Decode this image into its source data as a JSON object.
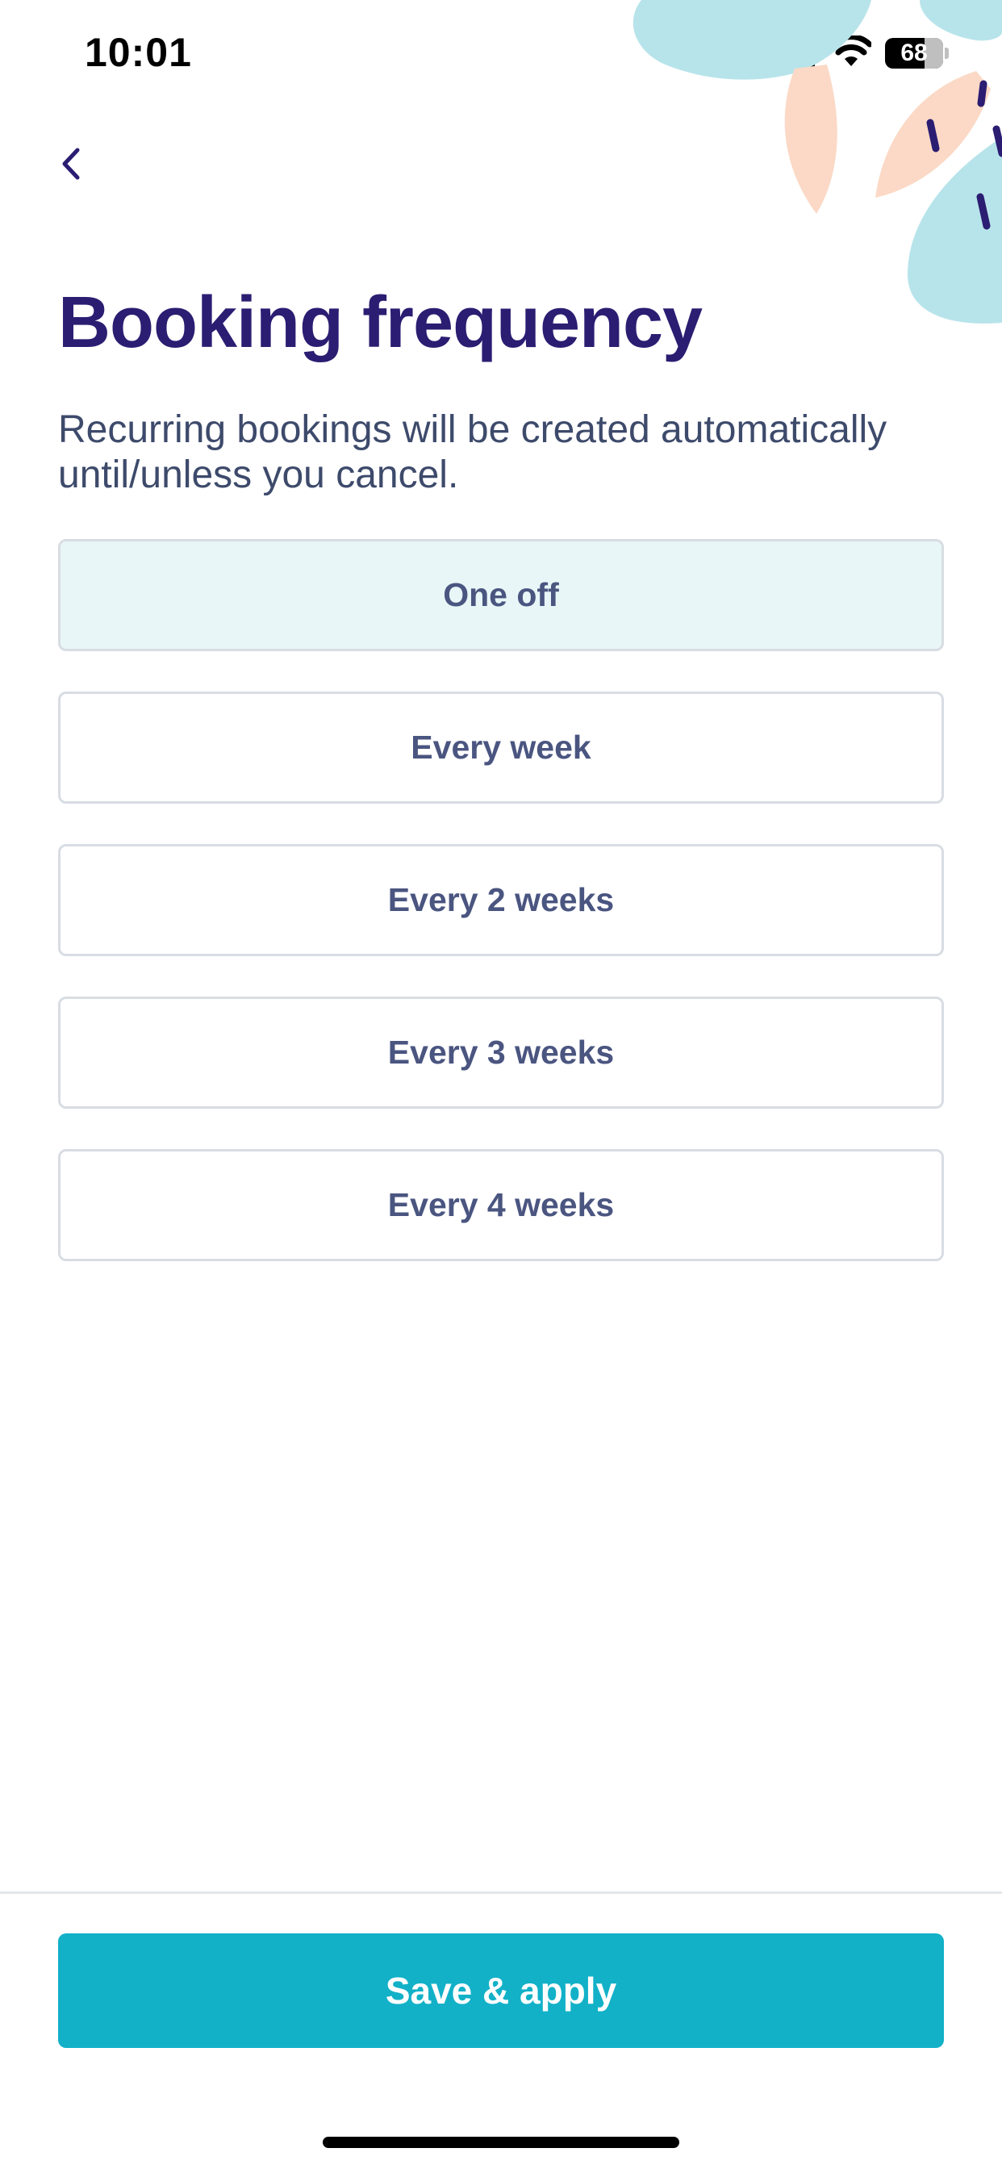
{
  "status_bar": {
    "time": "10:01",
    "battery_percent": "68",
    "battery_level": 0.68,
    "signal_icon": "cellular-signal-icon",
    "wifi_icon": "wifi-icon"
  },
  "navigation": {
    "back_icon": "chevron-left-icon"
  },
  "page": {
    "title": "Booking frequency",
    "description": "Recurring bookings will be created automatically until/unless you cancel."
  },
  "options": [
    {
      "label": "One off",
      "selected": true
    },
    {
      "label": "Every week",
      "selected": false
    },
    {
      "label": "Every 2 weeks",
      "selected": false
    },
    {
      "label": "Every 3 weeks",
      "selected": false
    },
    {
      "label": "Every 4 weeks",
      "selected": false
    }
  ],
  "footer": {
    "save_label": "Save & apply"
  },
  "colors": {
    "title": "#2b1d72",
    "body_text": "#3d4a6b",
    "option_text": "#4a5580",
    "option_border": "#d8dde3",
    "selected_background": "#e8f6f7",
    "primary_button": "#12b1c8",
    "decoration_blue": "#b7e4ea",
    "decoration_peach": "#fbd9c6",
    "decoration_stroke": "#2b1d72"
  }
}
